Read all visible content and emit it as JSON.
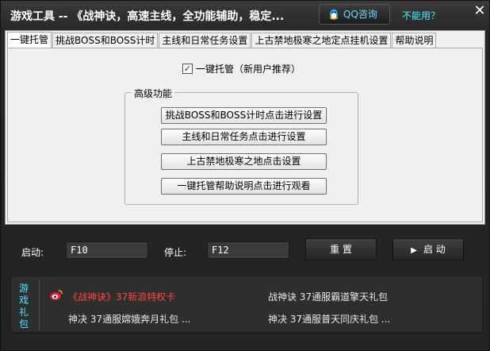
{
  "window": {
    "title": "游戏工具 -- 《战神诀，高速主线，全功能辅助，稳定...",
    "qq_label": "QQ咨询",
    "not_working": "不能用？",
    "close_glyph": "✕"
  },
  "tabs": [
    {
      "label": "一键托管",
      "active": true
    },
    {
      "label": "挑战BOSS和BOSS计时",
      "active": false
    },
    {
      "label": "主线和日常任务设置",
      "active": false
    },
    {
      "label": "上古禁地极寒之地定点挂机设置",
      "active": false
    },
    {
      "label": "帮助说明",
      "active": false
    }
  ],
  "auto": {
    "checkbox_label": "一键托管（新用户推荐）",
    "checked": true,
    "check_glyph": "✓"
  },
  "advanced": {
    "legend": "高级功能",
    "buttons": [
      "挑战BOSS和BOSS计时点击进行设置",
      "主线和日常任务点击进行设置",
      "上古禁地极寒之地点击设置",
      "一键托管帮助说明点击进行观看"
    ]
  },
  "controls": {
    "start_label": "启动:",
    "start_key": "F10",
    "stop_label": "停止:",
    "stop_key": "F12",
    "reset_label": "重 置",
    "run_label": "启 动",
    "play_glyph": "▶"
  },
  "gift": {
    "side_label": [
      "游",
      "戏",
      "礼",
      "包"
    ],
    "links": [
      "《战神诀》37新浪特权卡",
      "战神诀 37通服霸道擎天礼包",
      "神决 37通服嫦娥奔月礼包 ...",
      "神决 37通服普天同庆礼包 ..."
    ]
  },
  "colors": {
    "accent": "#4fe9ff",
    "hot_link": "#ff4444",
    "panel_bg": "#f0f0f0",
    "window_bg": "#262626"
  }
}
